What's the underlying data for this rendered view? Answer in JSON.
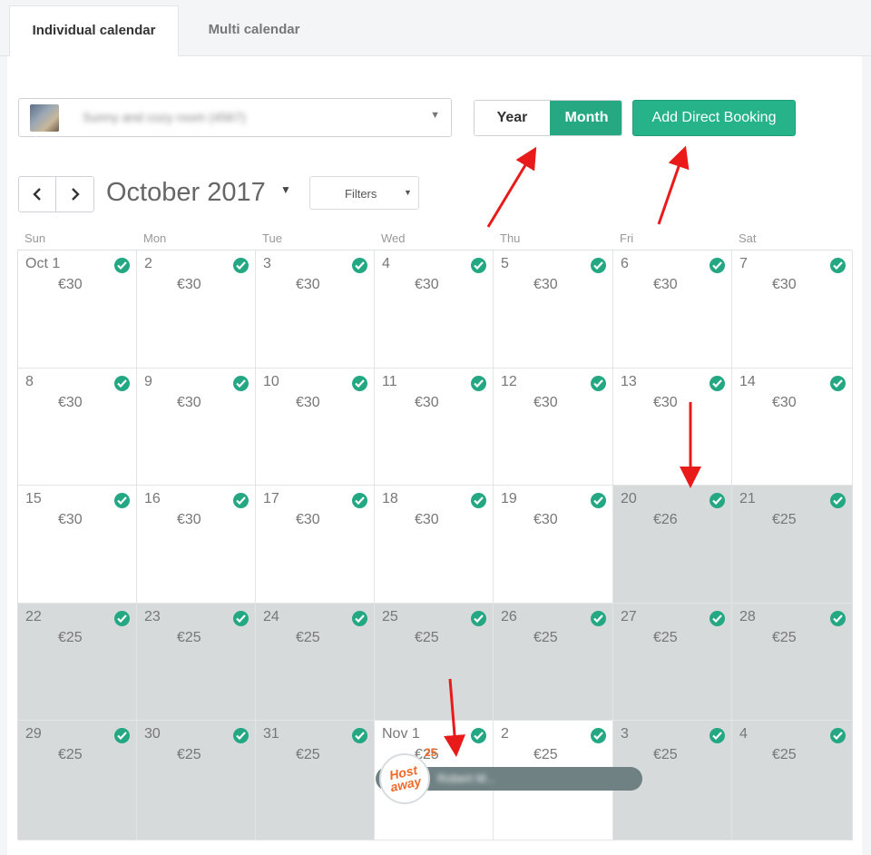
{
  "tabs": [
    {
      "label": "Individual calendar",
      "active": true
    },
    {
      "label": "Multi calendar",
      "active": false
    }
  ],
  "listing": {
    "name": "Sunny and cozy room (4567)",
    "blurred": true
  },
  "view_toggle": {
    "year": "Year",
    "month": "Month",
    "selected": "Month"
  },
  "add_booking_label": "Add Direct Booking",
  "calendar": {
    "month_title": "October 2017",
    "filters_label": "Filters",
    "weekdays": [
      "Sun",
      "Mon",
      "Tue",
      "Wed",
      "Thu",
      "Fri",
      "Sat"
    ],
    "weeks": [
      [
        {
          "d": "Oct 1",
          "p": "€30",
          "s": false
        },
        {
          "d": "2",
          "p": "€30",
          "s": false
        },
        {
          "d": "3",
          "p": "€30",
          "s": false
        },
        {
          "d": "4",
          "p": "€30",
          "s": false
        },
        {
          "d": "5",
          "p": "€30",
          "s": false
        },
        {
          "d": "6",
          "p": "€30",
          "s": false
        },
        {
          "d": "7",
          "p": "€30",
          "s": false
        }
      ],
      [
        {
          "d": "8",
          "p": "€30",
          "s": false
        },
        {
          "d": "9",
          "p": "€30",
          "s": false
        },
        {
          "d": "10",
          "p": "€30",
          "s": false
        },
        {
          "d": "11",
          "p": "€30",
          "s": false
        },
        {
          "d": "12",
          "p": "€30",
          "s": false
        },
        {
          "d": "13",
          "p": "€30",
          "s": false
        },
        {
          "d": "14",
          "p": "€30",
          "s": false
        }
      ],
      [
        {
          "d": "15",
          "p": "€30",
          "s": false
        },
        {
          "d": "16",
          "p": "€30",
          "s": false
        },
        {
          "d": "17",
          "p": "€30",
          "s": false
        },
        {
          "d": "18",
          "p": "€30",
          "s": false
        },
        {
          "d": "19",
          "p": "€30",
          "s": false
        },
        {
          "d": "20",
          "p": "€26",
          "s": true
        },
        {
          "d": "21",
          "p": "€25",
          "s": true
        }
      ],
      [
        {
          "d": "22",
          "p": "€25",
          "s": true
        },
        {
          "d": "23",
          "p": "€25",
          "s": true
        },
        {
          "d": "24",
          "p": "€25",
          "s": true
        },
        {
          "d": "25",
          "p": "€25",
          "s": true
        },
        {
          "d": "26",
          "p": "€25",
          "s": true
        },
        {
          "d": "27",
          "p": "€25",
          "s": true
        },
        {
          "d": "28",
          "p": "€25",
          "s": true
        }
      ],
      [
        {
          "d": "29",
          "p": "€25",
          "s": true
        },
        {
          "d": "30",
          "p": "€25",
          "s": true
        },
        {
          "d": "31",
          "p": "€25",
          "s": true
        },
        {
          "d": "Nov 1",
          "p": "€25",
          "s": false
        },
        {
          "d": "2",
          "p": "€25",
          "s": false
        },
        {
          "d": "3",
          "p": "€25",
          "s": true
        },
        {
          "d": "4",
          "p": "€25",
          "s": true
        }
      ]
    ]
  },
  "booking": {
    "guest": "Robert M...",
    "channel": "Hostaway",
    "channel_logo_text": "Host away",
    "price_tag": "25"
  },
  "colors": {
    "accent": "#26a983",
    "check": "#24a884",
    "shaded": "#d6dadb",
    "arrow": "#e81a1a",
    "booking_bar": "#6f8183",
    "hostaway": "#f06a2a"
  }
}
